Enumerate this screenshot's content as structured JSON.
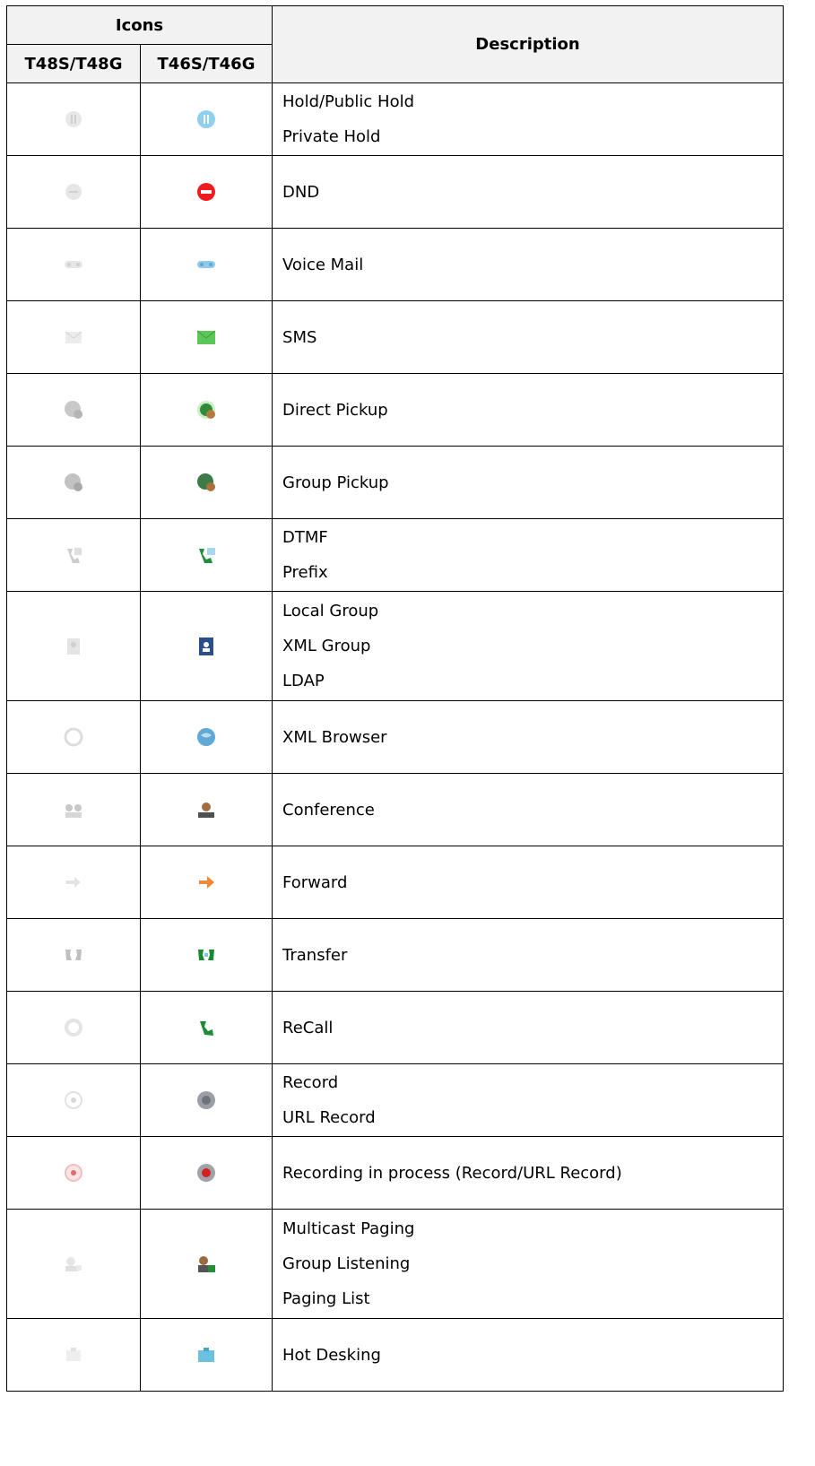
{
  "header": {
    "icons": "Icons",
    "col_a": "T48S/T48G",
    "col_b": "T46S/T46G",
    "description": "Description"
  },
  "rows": [
    {
      "h": 81,
      "icon_a": "hold-icon-gray",
      "icon_b": "hold-icon-blue",
      "lines": [
        "Hold/Public Hold",
        "Private Hold"
      ]
    },
    {
      "h": 81,
      "icon_a": "dnd-icon-gray",
      "icon_b": "dnd-icon-red",
      "lines": [
        "DND"
      ]
    },
    {
      "h": 81,
      "icon_a": "voicemail-icon-gray",
      "icon_b": "voicemail-icon-blue",
      "lines": [
        "Voice Mail"
      ]
    },
    {
      "h": 81,
      "icon_a": "sms-icon-gray",
      "icon_b": "sms-icon-green",
      "lines": [
        "SMS"
      ]
    },
    {
      "h": 81,
      "icon_a": "direct-pickup-icon-gray",
      "icon_b": "direct-pickup-icon-color",
      "lines": [
        "Direct Pickup"
      ]
    },
    {
      "h": 81,
      "icon_a": "group-pickup-icon-gray",
      "icon_b": "group-pickup-icon-color",
      "lines": [
        "Group Pickup"
      ]
    },
    {
      "h": 81,
      "icon_a": "dtmf-icon-gray",
      "icon_b": "dtmf-icon-green",
      "lines": [
        "DTMF",
        "Prefix"
      ]
    },
    {
      "h": 122,
      "icon_a": "directory-icon-gray",
      "icon_b": "directory-icon-blue",
      "lines": [
        "Local Group",
        "XML Group",
        "LDAP"
      ]
    },
    {
      "h": 81,
      "icon_a": "xml-browser-icon-gray",
      "icon_b": "xml-browser-icon-blue",
      "lines": [
        "XML Browser"
      ]
    },
    {
      "h": 81,
      "icon_a": "conference-icon-gray",
      "icon_b": "conference-icon-color",
      "lines": [
        "Conference"
      ]
    },
    {
      "h": 81,
      "icon_a": "forward-icon-gray",
      "icon_b": "forward-icon-orange",
      "lines": [
        "Forward"
      ]
    },
    {
      "h": 81,
      "icon_a": "transfer-icon-gray",
      "icon_b": "transfer-icon-green",
      "lines": [
        "Transfer"
      ]
    },
    {
      "h": 81,
      "icon_a": "recall-icon-gray",
      "icon_b": "recall-icon-green",
      "lines": [
        "ReCall"
      ]
    },
    {
      "h": 81,
      "icon_a": "record-icon-gray",
      "icon_b": "record-icon-color",
      "lines": [
        "Record",
        "URL Record"
      ]
    },
    {
      "h": 81,
      "icon_a": "recording-icon-gray",
      "icon_b": "recording-icon-color",
      "lines": [
        "Recording in process (Record/URL Record)"
      ]
    },
    {
      "h": 122,
      "icon_a": "paging-icon-gray",
      "icon_b": "paging-icon-color",
      "lines": [
        "Multicast Paging",
        "Group Listening",
        "Paging List"
      ]
    },
    {
      "h": 81,
      "icon_a": "hot-desking-icon-gray",
      "icon_b": "hot-desking-icon-blue",
      "lines": [
        "Hot Desking"
      ]
    }
  ]
}
